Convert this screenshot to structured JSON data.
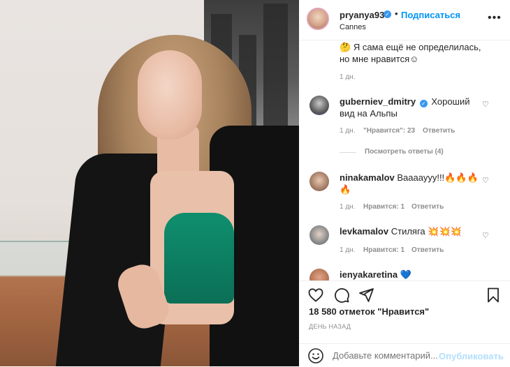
{
  "post": {
    "username": "pryanya93",
    "verified": true,
    "separator": "•",
    "follow_label": "Подписаться",
    "location": "Cannes",
    "more_icon": "more-horizontal-icon"
  },
  "comments": [
    {
      "text": "Я сама ещё не определилась, но мне нравится",
      "emoji_before": "🤔",
      "emoji_after": "☺",
      "time": "1 дн."
    },
    {
      "username": "guberniev_dmitry",
      "verified": true,
      "text": "Хороший вид на Альпы",
      "time": "1 дн.",
      "likes": "\"Нравится\": 23",
      "reply": "Ответить",
      "view_replies": "Посмотреть ответы (4)"
    },
    {
      "username": "ninakamalov",
      "text": "Вааааууу!!!🔥🔥🔥🔥",
      "time": "1 дн.",
      "likes": "Нравится: 1",
      "reply": "Ответить"
    },
    {
      "username": "levkamalov",
      "text": "Стиляга 💥💥💥",
      "time": "1 дн.",
      "likes": "Нравится: 1",
      "reply": "Ответить"
    },
    {
      "username": "ienyakaretina",
      "text": "💙"
    }
  ],
  "actions": {
    "like_icon": "heart-icon",
    "comment_icon": "comment-icon",
    "share_icon": "share-icon",
    "save_icon": "bookmark-icon"
  },
  "likes_text": "18 580 отметок \"Нравится\"",
  "date": "ДЕНЬ НАЗАД",
  "add_comment": {
    "placeholder": "Добавьте комментарий...",
    "publish_label": "Опубликовать"
  },
  "colors": {
    "accent": "#0095f6",
    "verified": "#3897f0",
    "muted": "#8e8e8e",
    "publish_disabled": "#b2dffc"
  }
}
